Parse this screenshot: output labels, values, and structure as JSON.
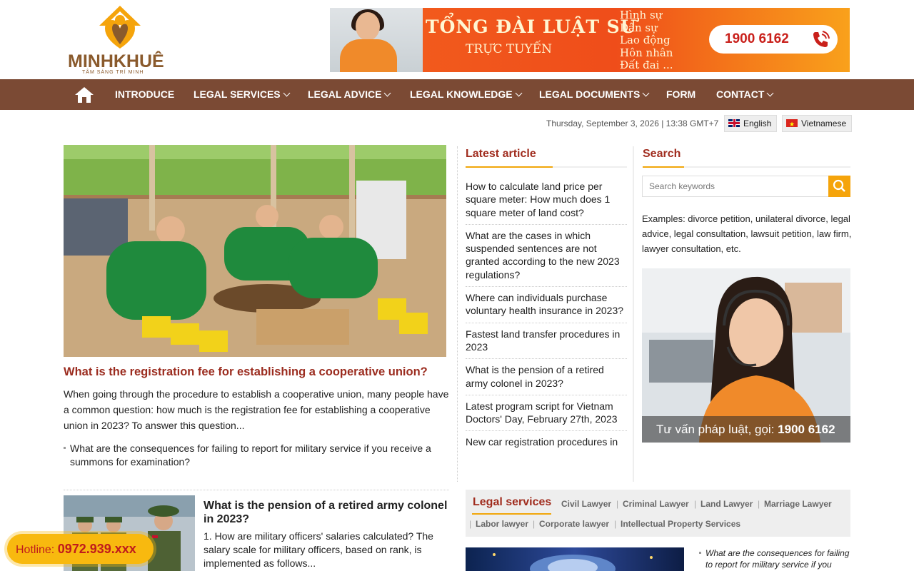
{
  "brand": {
    "name": "MINHKHUÊ",
    "slogan": "TÂM SÁNG TRÍ MINH",
    "logo_colors": {
      "primary": "#f5a40b",
      "secondary": "#8a5a2c"
    }
  },
  "banner": {
    "title": "TỔNG ĐÀI LUẬT SƯ",
    "subtitle": "TRỰC TUYẾN",
    "areas": [
      "Hình sự",
      "Dân sự",
      "Lao động",
      "Hôn nhân",
      "Đất đai ..."
    ],
    "phone": "1900 6162"
  },
  "nav": {
    "home_icon": "home-icon",
    "items": [
      {
        "label": "INTRODUCE",
        "dropdown": false
      },
      {
        "label": "LEGAL SERVICES",
        "dropdown": true
      },
      {
        "label": "LEGAL ADVICE",
        "dropdown": true
      },
      {
        "label": "LEGAL KNOWLEDGE",
        "dropdown": true
      },
      {
        "label": "LEGAL DOCUMENTS",
        "dropdown": true
      },
      {
        "label": "FORM",
        "dropdown": false
      },
      {
        "label": "CONTACT",
        "dropdown": true
      }
    ],
    "color": "#7b4a34"
  },
  "datebar": {
    "text": "Thursday, September 3, 2026 | 13:38 GMT+7",
    "languages": [
      "English",
      "Vietnamese"
    ]
  },
  "featured": {
    "title": "What is the registration fee for establishing a cooperative union?",
    "description": "When going through the procedure to establish a cooperative union, many people have a common question: how much is the registration fee for establishing a cooperative union in 2023? To answer this question...",
    "related": "What are the consequences for failing to report for military service if you receive a summons for examination?"
  },
  "latest": {
    "title": "Latest article",
    "items": [
      "How to calculate land price per square meter: How much does 1 square meter of land cost?",
      "What are the cases in which suspended sentences are not granted according to the new 2023 regulations?",
      "Where can individuals purchase voluntary health insurance in 2023?",
      "Fastest land transfer procedures in 2023",
      "What is the pension of a retired army colonel in 2023?",
      "Latest program script for Vietnam Doctors' Day, February 27th, 2023",
      "New car registration procedures in"
    ]
  },
  "search": {
    "title": "Search",
    "placeholder": "Search keywords",
    "examples": "Examples: divorce petition, unilateral divorce, legal advice, legal consultation, lawsuit petition, law firm, lawyer consultation, etc."
  },
  "ad": {
    "caption_prefix": "Tư vấn pháp luật, gọi:",
    "caption_phone": "1900 6162"
  },
  "article2": {
    "title": "What is the pension of a retired army colonel in 2023?",
    "description": "1. How are military officers' salaries calculated? The salary scale for military officers, based on rank, is implemented as follows..."
  },
  "legal_services": {
    "title": "Legal services",
    "links": [
      "Civil Lawyer",
      "Criminal Lawyer",
      "Land Lawyer",
      "Marriage Lawyer",
      "Labor lawyer",
      "Corporate lawyer",
      "Intellectual Property Services"
    ],
    "related": "What are the consequences for failing to report for military service if you"
  },
  "hotline": {
    "label": "Hotline:",
    "number": "0972.939.xxx"
  },
  "colors": {
    "accent": "#f5a40b",
    "title_red": "#a02c1e"
  }
}
